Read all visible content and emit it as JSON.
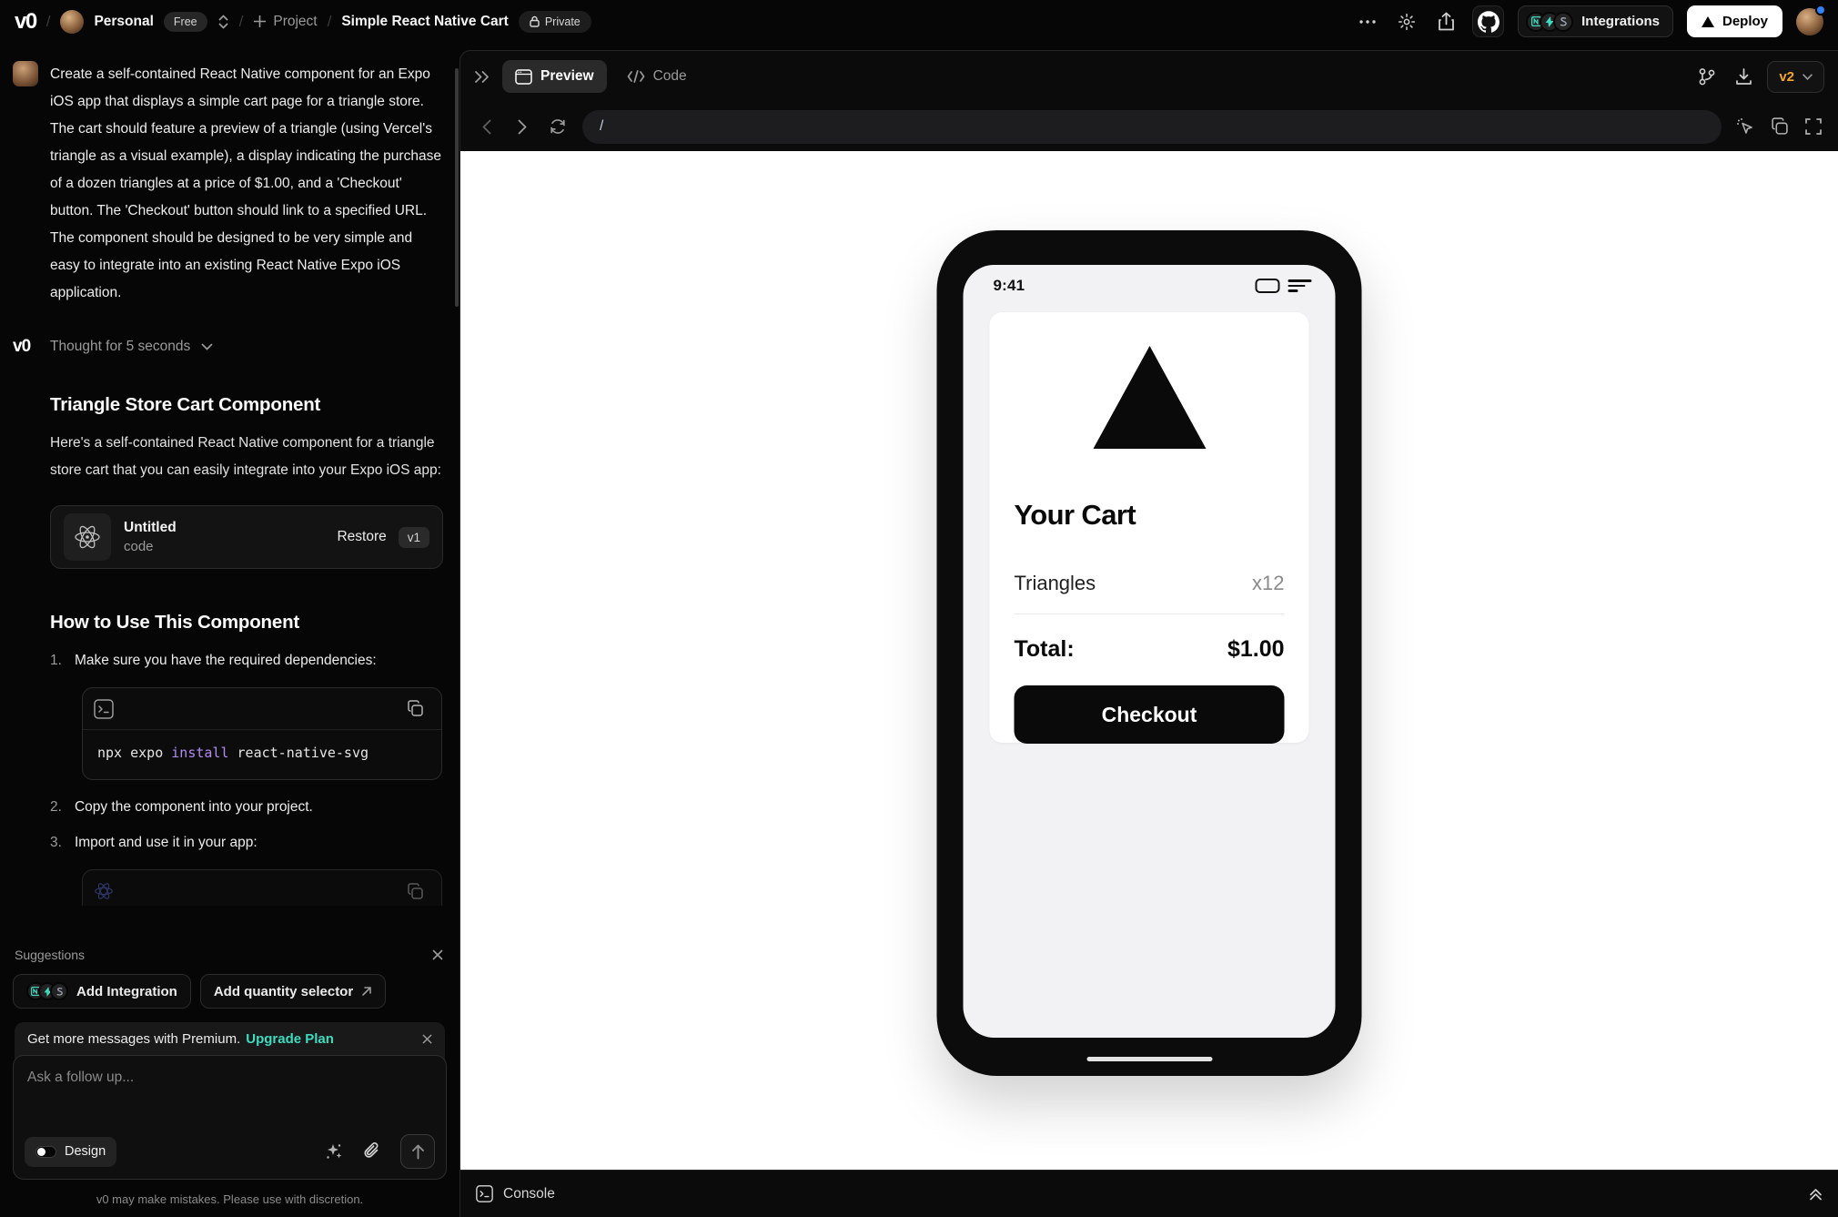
{
  "header": {
    "logo": "v0",
    "workspace": "Personal",
    "plan_badge": "Free",
    "new_project_label": "Project",
    "chat_title": "Simple React Native Cart",
    "privacy_badge": "Private",
    "integrations_label": "Integrations",
    "deploy_label": "Deploy"
  },
  "chat": {
    "user_message": "Create a self-contained React Native component for an Expo iOS app that displays a simple cart page for a triangle store. The cart should feature a preview of a triangle (using Vercel's triangle as a visual example), a display indicating the purchase of a dozen triangles at a price of $1.00, and a 'Checkout' button. The 'Checkout' button should link to a specified URL. The component should be designed to be very simple and easy to integrate into an existing React Native Expo iOS application.",
    "thought_label": "Thought for 5 seconds",
    "response_title": "Triangle Store Cart Component",
    "response_intro": "Here's a self-contained React Native component for a triangle store cart that you can easily integrate into your Expo iOS app:",
    "version_card": {
      "title": "Untitled",
      "subtitle": "code",
      "restore_label": "Restore",
      "version_badge": "v1"
    },
    "howto_title": "How to Use This Component",
    "steps": [
      {
        "num": "1.",
        "text": "Make sure you have the required dependencies:"
      },
      {
        "num": "2.",
        "text": "Copy the component into your project."
      },
      {
        "num": "3.",
        "text": "Import and use it in your app:"
      }
    ],
    "code": {
      "p1": "npx expo ",
      "p2": "install",
      "p3": " react-native-svg"
    }
  },
  "suggestions": {
    "label": "Suggestions",
    "items": [
      {
        "label": "Add Integration"
      },
      {
        "label": "Add quantity selector"
      }
    ]
  },
  "composer": {
    "premium_text": "Get more messages with Premium.",
    "premium_link": "Upgrade Plan",
    "placeholder": "Ask a follow up...",
    "design_toggle_label": "Design",
    "disclaimer": "v0 may make mistakes. Please use with discretion."
  },
  "preview": {
    "tab_preview": "Preview",
    "tab_code": "Code",
    "url": "/",
    "version_selector": "v2",
    "console_label": "Console"
  },
  "phone": {
    "status_time": "9:41",
    "cart_title": "Your Cart",
    "item_name": "Triangles",
    "item_qty": "x12",
    "total_label": "Total:",
    "total_value": "$1.00",
    "checkout_label": "Checkout"
  },
  "colors": {
    "accent_teal": "#3ddbc0",
    "version_amber": "#f5a623",
    "code_keyword_purple": "#b48af3",
    "notification_blue": "#2f81f7"
  }
}
